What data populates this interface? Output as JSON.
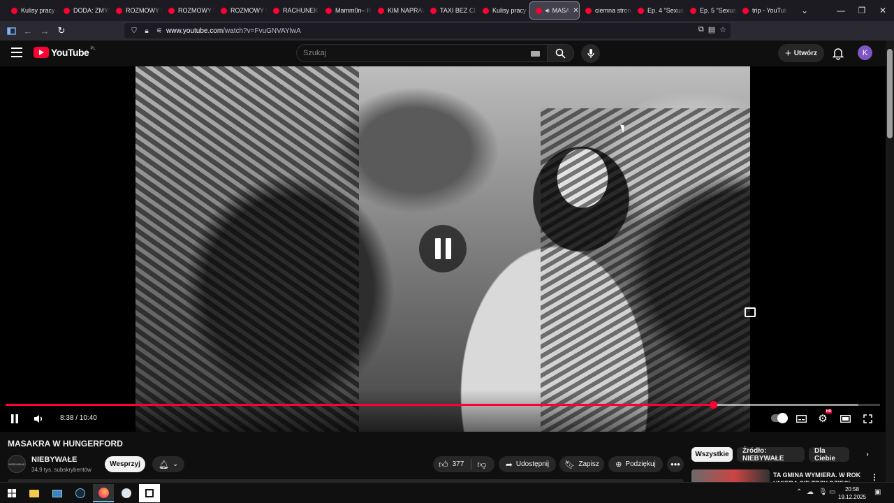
{
  "browser": {
    "tabs": [
      {
        "label": "Kulisy pracy p"
      },
      {
        "label": "DODA: ZMYŚ"
      },
      {
        "label": "ROZMOWY W"
      },
      {
        "label": "ROZMOWY W"
      },
      {
        "label": "ROZMOWY W"
      },
      {
        "label": "RACHUNEK S"
      },
      {
        "label": "Mamm0n– R"
      },
      {
        "label": "KIM NAPRAW"
      },
      {
        "label": "TAXI BEZ CEN"
      },
      {
        "label": "Kulisy pracy p"
      },
      {
        "label": "MASA",
        "active": true,
        "audio": true
      },
      {
        "label": "ciemna strona"
      },
      {
        "label": "Ep. 4 \"Sexual"
      },
      {
        "label": "Ep. 5 \"Sexual"
      },
      {
        "label": "trip - YouTub"
      }
    ],
    "url_domain": "www.youtube.com",
    "url_path": "/watch?v=FvuGNVAYlwA",
    "extension_badge": "69"
  },
  "youtube": {
    "logo_text": "YouTube",
    "logo_country": "PL",
    "search_placeholder": "Szukaj",
    "create_label": "Utwórz",
    "avatar_letter": "K",
    "accent": "#ff0033"
  },
  "player": {
    "current_time": "8:38",
    "duration": "10:40",
    "time_display": "8:38 / 10:40",
    "progress_fraction": 0.809,
    "buffered_fraction": 0.975,
    "state": "paused-overlay"
  },
  "video": {
    "title": "MASAKRA W HUNGERFORD",
    "channel_name": "NIEBYWAŁE",
    "channel_avatar_text": "NIEBYWAŁE",
    "subscribers": "34,9 tys. subskrybentów",
    "support_label": "Wesprzyj",
    "likes": "377",
    "share_label": "Udostępnij",
    "save_label": "Zapisz",
    "thanks_label": "Podziękuj"
  },
  "sidebar": {
    "filters": [
      "Wszystkie",
      "Źródło: NIEBYWAŁE",
      "Dla Ciebie"
    ],
    "rec_title": "TA GMINA WYMIERA. W ROK UMIERA SIĘ TRZY DZIECI"
  },
  "taskbar": {
    "time": "20:58",
    "date": "19.12.2025"
  }
}
